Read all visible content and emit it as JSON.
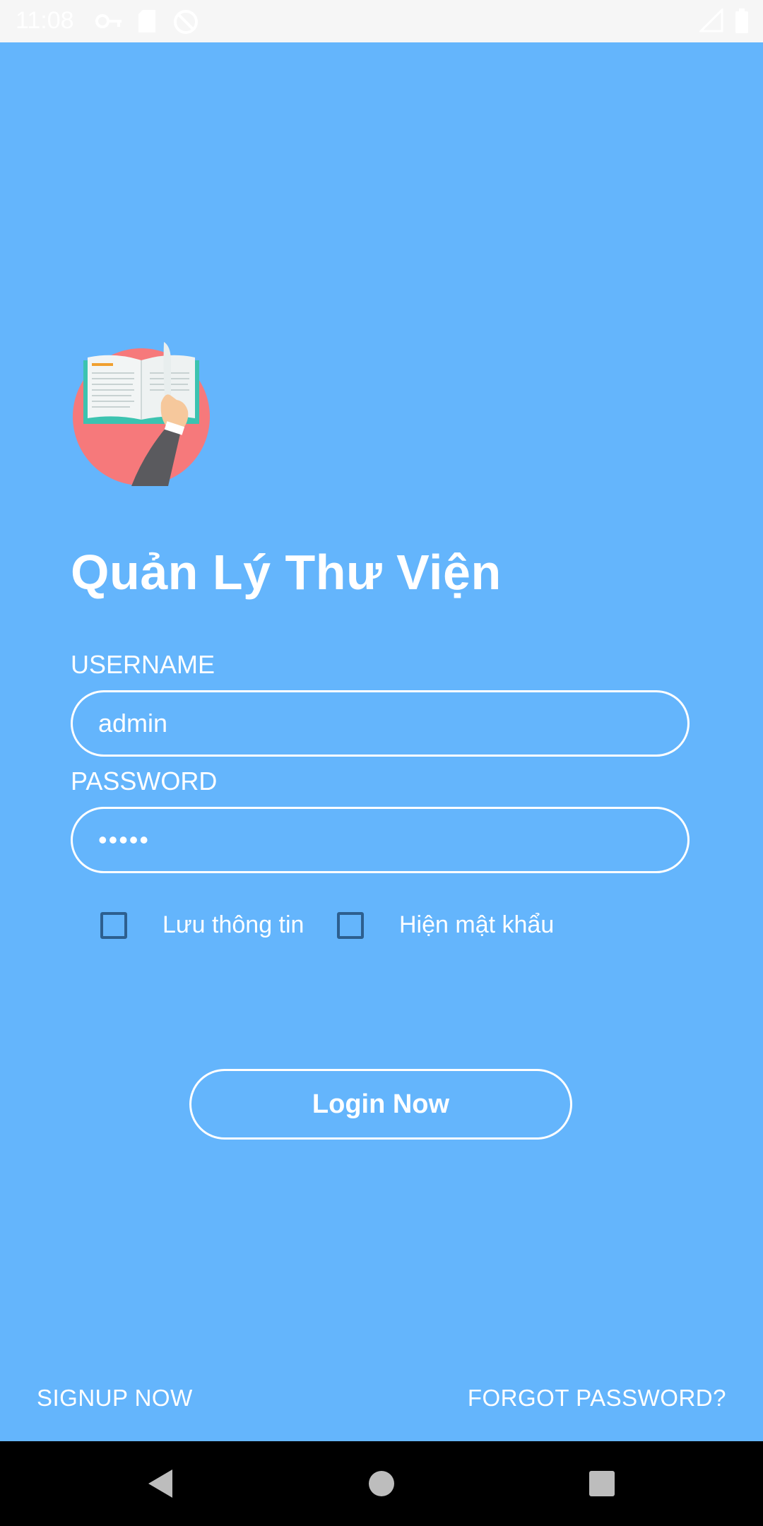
{
  "status_bar": {
    "time": "11:08",
    "icons": [
      "vpn-key-icon",
      "sd-card-icon",
      "no-sync-icon",
      "signal-icon",
      "battery-icon"
    ]
  },
  "app": {
    "title": "Quản Lý Thư Viện",
    "logo_icon": "open-book-logo-icon"
  },
  "form": {
    "username_label": "USERNAME",
    "username_value": "admin",
    "password_label": "PASSWORD",
    "password_value": "•••••",
    "remember_label": "Lưu thông tin",
    "show_password_label": "Hiện mật khẩu",
    "login_button": "Login Now"
  },
  "links": {
    "signup": "SIGNUP NOW",
    "forgot": "FORGOT PASSWORD?"
  },
  "nav_bar": {
    "icons": [
      "back-icon",
      "home-icon",
      "recents-icon"
    ]
  },
  "colors": {
    "background": "#64b5fc",
    "logo_circle": "#f6797b",
    "accent_white": "#ffffff",
    "checkbox_border": "#2d5f8f"
  }
}
